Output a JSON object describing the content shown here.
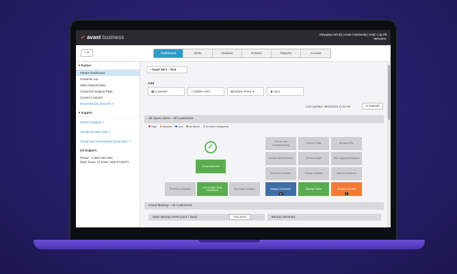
{
  "brand": {
    "mark": "✓",
    "name": "avast",
    "suffix": "business"
  },
  "toplinks": {
    "line1": "Shopping Cart (0)  |  Avast Community  |  Help  |  Log Off",
    "line2": "Welcome:"
  },
  "tabs": [
    "Dashboard",
    "Alerts",
    "Devices",
    "Policies",
    "Reports",
    "Account"
  ],
  "sidebar": {
    "partner_heading": "Partner",
    "partner_items": [
      "Partner Dashboard",
      "Customer List",
      "Sales Opportunities",
      "Customize Support Page",
      "Convert Licenses"
    ],
    "email_link": "Email Security Services",
    "support_heading": "Support",
    "support_links": [
      "Partner Support",
      "CloudCare Web Help",
      "CloudCare Administrator Quick Start"
    ],
    "us_support_label": "US Support:",
    "phone": "Phone: +1 855-738-1264",
    "hours": "Open hours: 24 hours, Mon-Fri (EST)"
  },
  "main": {
    "site": "Avast SE's - Test",
    "add_label": "Add",
    "add_fields": [
      "Customer",
      "Master Alert",
      "Master Policy",
      "User"
    ],
    "updated": "Last Updated: 08/30/2018 11:02 AM",
    "refresh": "Refresh",
    "alerts_heading": "All Open Alerts - All Customers",
    "legend": [
      "High",
      "Medium",
      "Low",
      "No Alerts",
      "No Alert Configured"
    ],
    "legend_colors": [
      "#e04a3a",
      "#f0a030",
      "#3d6ea8",
      "#5aad4e",
      "#bbbbbb"
    ],
    "threat": "Threat Detected",
    "bottom_tiles": [
      "Protection Disabled",
      "Out-of-Date Virus Definitions",
      "Boot Scan Overdue"
    ],
    "grid_tiles": [
      "Service Not Communicating",
      "Service Trials",
      "Blocked URL",
      "Service Needs Reboot",
      "Service Install",
      "Disk Capacity Reached",
      "Windows Services",
      "Service Updates",
      "Memory Reached"
    ],
    "backup_tiles": [
      {
        "label": "Backup Successful",
        "count": "24",
        "color": "blue"
      },
      {
        "label": "Backup Failed",
        "count": "",
        "color": "green"
      },
      {
        "label": "Backup Overdue",
        "count": "1",
        "color": "orange"
      }
    ],
    "cloud_heading": "Cloud Backup - All Customers",
    "open_backup": "Open Backup Alerts (Last 7 days)",
    "view_alerts": "View Alerts",
    "backup_summary": "Backup Summary"
  }
}
